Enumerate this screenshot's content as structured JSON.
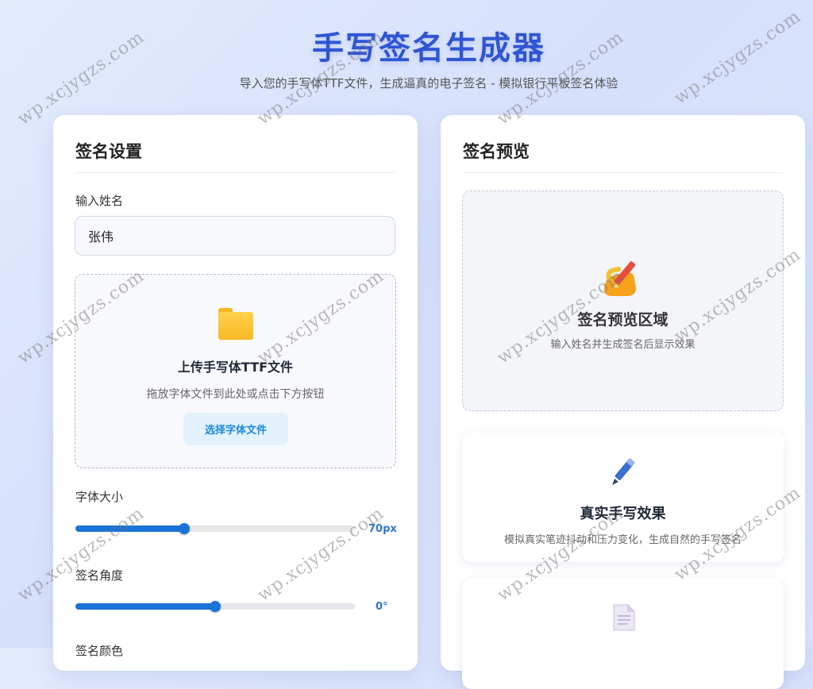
{
  "header": {
    "title": "手写签名生成器",
    "subtitle": "导入您的手写体TTF文件，生成逼真的电子签名 - 模拟银行平板签名体验"
  },
  "settings": {
    "heading": "签名设置",
    "name_label": "输入姓名",
    "name_value": "张伟",
    "upload": {
      "icon": "folder-icon",
      "title": "上传手写体TTF文件",
      "hint": "拖放字体文件到此处或点击下方按钮",
      "button_label": "选择字体文件"
    },
    "font_size": {
      "label": "字体大小",
      "value_text": "70px",
      "fraction": 0.39
    },
    "angle": {
      "label": "签名角度",
      "value_text": "0°",
      "fraction": 0.5
    },
    "color_label": "签名颜色"
  },
  "preview": {
    "heading": "签名预览",
    "area_icon": "writing-hand-icon",
    "area_title": "签名预览区域",
    "area_hint": "输入姓名并生成签名后显示效果",
    "features": [
      {
        "icon": "pen-icon",
        "title": "真实手写效果",
        "desc": "模拟真实笔迹抖动和压力变化，生成自然的手写签名"
      },
      {
        "icon": "document-icon"
      }
    ]
  },
  "watermark_text": "wp.xcjygzs.com",
  "colors": {
    "accent": "#1a73d6",
    "title": "#2f55d4",
    "folder": "#f9b722"
  }
}
